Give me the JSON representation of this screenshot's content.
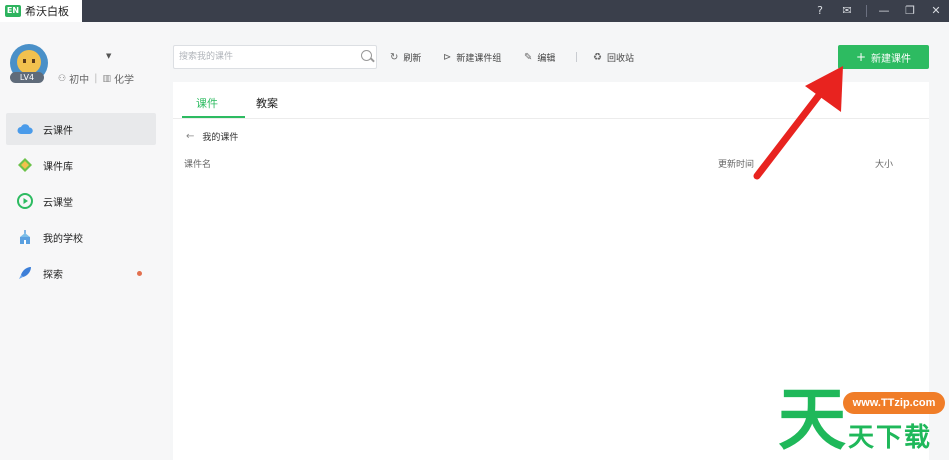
{
  "window": {
    "app_logo_text": "EN",
    "app_name": "希沃白板"
  },
  "user": {
    "level": "LV4",
    "grade": "初中",
    "subject": "化学"
  },
  "sidebar": {
    "items": [
      {
        "label": "云课件",
        "icon": "cloud-icon"
      },
      {
        "label": "课件库",
        "icon": "library-icon"
      },
      {
        "label": "云课堂",
        "icon": "play-icon"
      },
      {
        "label": "我的学校",
        "icon": "school-icon"
      },
      {
        "label": "探索",
        "icon": "rocket-icon"
      }
    ]
  },
  "toolbar": {
    "search_placeholder": "搜索我的课件",
    "refresh": "刷新",
    "new_group": "新建课件组",
    "edit": "编辑",
    "recycle": "回收站",
    "new_courseware": "新建课件"
  },
  "main": {
    "tabs": [
      "课件",
      "教案"
    ],
    "breadcrumb": "我的课件",
    "columns": {
      "name": "课件名",
      "updated": "更新时间",
      "size": "大小"
    }
  },
  "watermark": {
    "url": "www.TTzip.com",
    "big_char": "天",
    "text": "天下载"
  },
  "colors": {
    "accent": "#2dbb61",
    "titlebar": "#3a3f4b",
    "arrow": "#e8231f",
    "badge_dot": "#e2704f"
  }
}
